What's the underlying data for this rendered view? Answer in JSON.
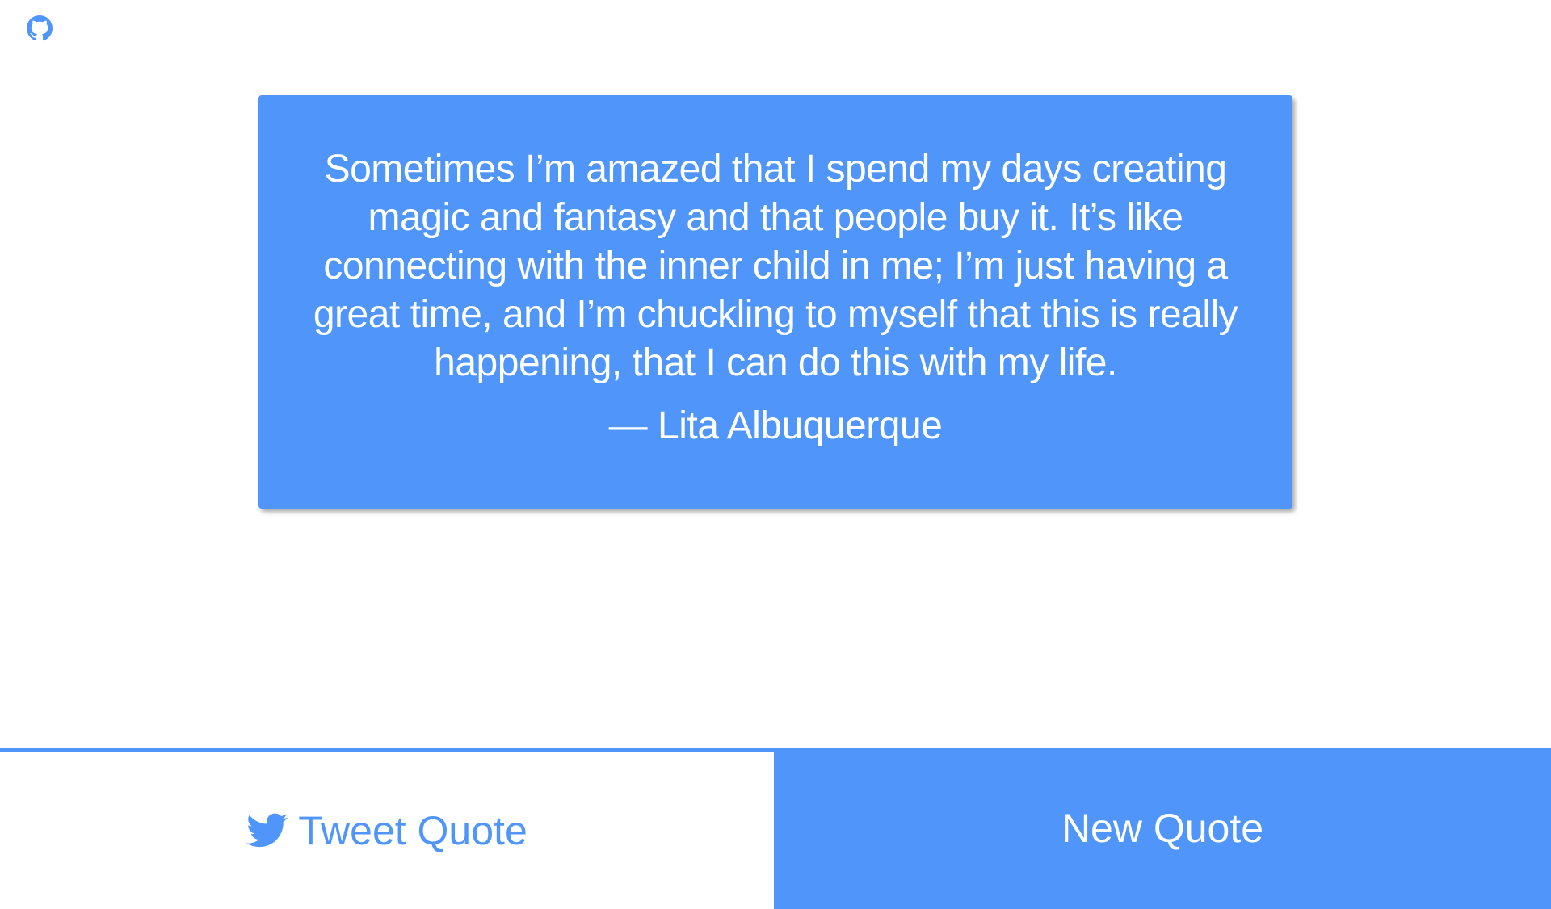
{
  "header": {
    "github_icon": "github-icon"
  },
  "quote": {
    "text": "Sometimes I’m amazed that I spend my days creating magic and fantasy and that people buy it. It’s like connecting with the inner child in me; I’m just having a great time, and I’m chuckling to myself that this is really happening, that I can do this with my life.",
    "author": "— Lita Albuquerque"
  },
  "actions": {
    "tweet_label": "Tweet Quote",
    "tweet_icon": "twitter-bird-icon",
    "new_label": "New Quote"
  },
  "colors": {
    "accent": "#5096fa",
    "background": "#ffffff",
    "text_on_accent": "#ffffff"
  }
}
